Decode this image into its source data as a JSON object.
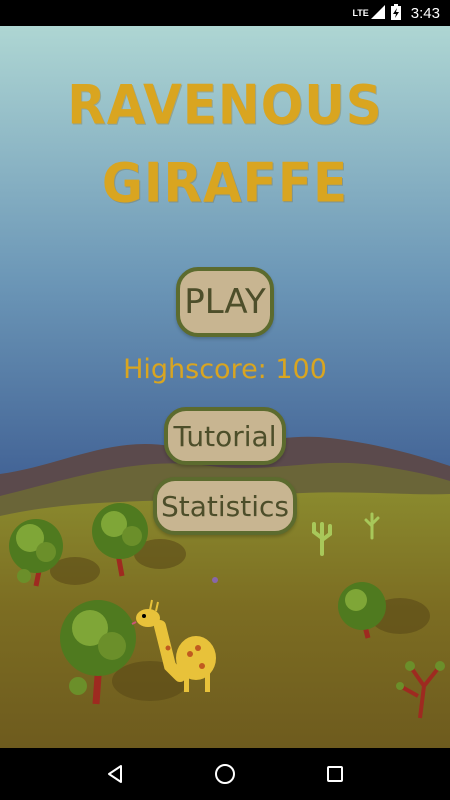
{
  "status_bar": {
    "network_label": "LTE",
    "time": "3:43",
    "icons": [
      "signal-icon",
      "battery-charging-icon"
    ]
  },
  "game": {
    "title_line1": "RAVENOUS",
    "title_line2": "GIRAFFE",
    "highscore_text": "Highscore: 100",
    "buttons": {
      "play": "PLAY",
      "tutorial": "Tutorial",
      "statistics": "Statistics"
    }
  },
  "nav_bar": {
    "icons": [
      "back-icon",
      "home-icon",
      "recents-icon"
    ]
  },
  "colors": {
    "title": "#d9a520",
    "button_fill": "#c8b591",
    "button_border": "#5c6b2e",
    "button_text": "#4d4e2a",
    "sky_top": "#a8d0cf",
    "sky_bottom": "#3c5a8a",
    "ground": "#7a6a22"
  }
}
